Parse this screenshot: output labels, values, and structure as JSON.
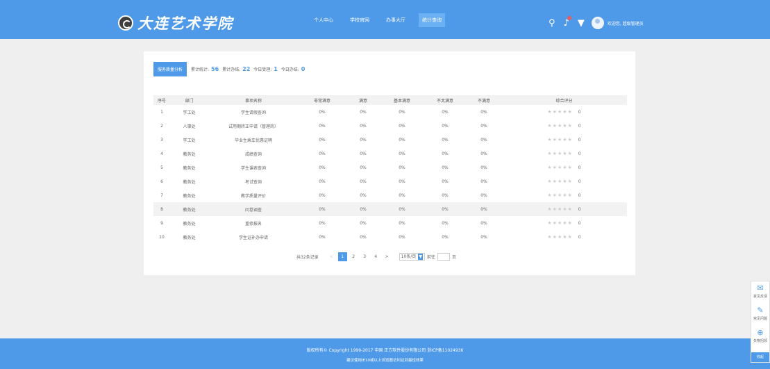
{
  "header": {
    "logo_text": "大连艺术学院",
    "nav": [
      "个人中心",
      "学校官网",
      "办事大厅",
      "统计查询"
    ],
    "active_nav": 3,
    "welcome": "欢迎您, 超级管理员"
  },
  "summary": {
    "button": "服务质量分析",
    "total_label": "累计统计:",
    "total": "56",
    "done_label": "累计办结:",
    "done": "22",
    "today_reg_label": "今日受理:",
    "today_reg": "1",
    "today_done_label": "今日办结:",
    "today_done": "0"
  },
  "table": {
    "headers": [
      "序号",
      "部门",
      "事项名称",
      "非常满意",
      "满意",
      "基本满意",
      "不太满意",
      "不满意",
      "综合评分"
    ],
    "rows": [
      {
        "no": "1",
        "dept": "学工处",
        "name": "学生请假查询",
        "v1": "0%",
        "v2": "0%",
        "v3": "0%",
        "v4": "0%",
        "v5": "0%",
        "stars": "★★★★★",
        "score": "0"
      },
      {
        "no": "2",
        "dept": "人事处",
        "name": "试用期转正申请（管理岗）",
        "v1": "0%",
        "v2": "0%",
        "v3": "0%",
        "v4": "0%",
        "v5": "0%",
        "stars": "★★★★★",
        "score": "0"
      },
      {
        "no": "3",
        "dept": "学工处",
        "name": "毕业生乘车优惠证明",
        "v1": "0%",
        "v2": "0%",
        "v3": "0%",
        "v4": "0%",
        "v5": "0%",
        "stars": "★★★★★",
        "score": "0"
      },
      {
        "no": "4",
        "dept": "教务处",
        "name": "成绩查询",
        "v1": "0%",
        "v2": "0%",
        "v3": "0%",
        "v4": "0%",
        "v5": "0%",
        "stars": "★★★★★",
        "score": "0"
      },
      {
        "no": "5",
        "dept": "教务处",
        "name": "学生课表查询",
        "v1": "0%",
        "v2": "0%",
        "v3": "0%",
        "v4": "0%",
        "v5": "0%",
        "stars": "★★★★★",
        "score": "0"
      },
      {
        "no": "6",
        "dept": "教务处",
        "name": "考试查询",
        "v1": "0%",
        "v2": "0%",
        "v3": "0%",
        "v4": "0%",
        "v5": "0%",
        "stars": "★★★★★",
        "score": "0"
      },
      {
        "no": "7",
        "dept": "教务处",
        "name": "教学质量评价",
        "v1": "0%",
        "v2": "0%",
        "v3": "0%",
        "v4": "0%",
        "v5": "0%",
        "stars": "★★★★★",
        "score": "0"
      },
      {
        "no": "8",
        "dept": "教务处",
        "name": "问卷调查",
        "v1": "0%",
        "v2": "0%",
        "v3": "0%",
        "v4": "0%",
        "v5": "0%",
        "stars": "★★★★★",
        "score": "0"
      },
      {
        "no": "9",
        "dept": "教务处",
        "name": "重修报名",
        "v1": "0%",
        "v2": "0%",
        "v3": "0%",
        "v4": "0%",
        "v5": "0%",
        "stars": "★★★★★",
        "score": "0"
      },
      {
        "no": "10",
        "dept": "教务处",
        "name": "学生证补办申请",
        "v1": "0%",
        "v2": "0%",
        "v3": "0%",
        "v4": "0%",
        "v5": "0%",
        "stars": "★★★★★",
        "score": "0"
      }
    ]
  },
  "pager": {
    "total_text": "共32条记录",
    "pages": [
      "1",
      "2",
      "3",
      "4"
    ],
    "active_page": 0,
    "page_size": "10条/页",
    "goto_label": "前往",
    "page_suffix": "页"
  },
  "footer": {
    "line1": "版权所有© Copyright 1999-2017 中国 正方软件股份有限公司 浙ICP备11024936",
    "line2": "建议使用IE10或以上浏览器访问达到最佳效果"
  },
  "side": {
    "items": [
      "意见反馈",
      "常见问题",
      "失物招领"
    ],
    "collapse": "收起"
  },
  "colors": {
    "primary": "#4f9ae8",
    "nav_active": "#6bb0f2",
    "row_highlight": "#f2f2f2"
  }
}
